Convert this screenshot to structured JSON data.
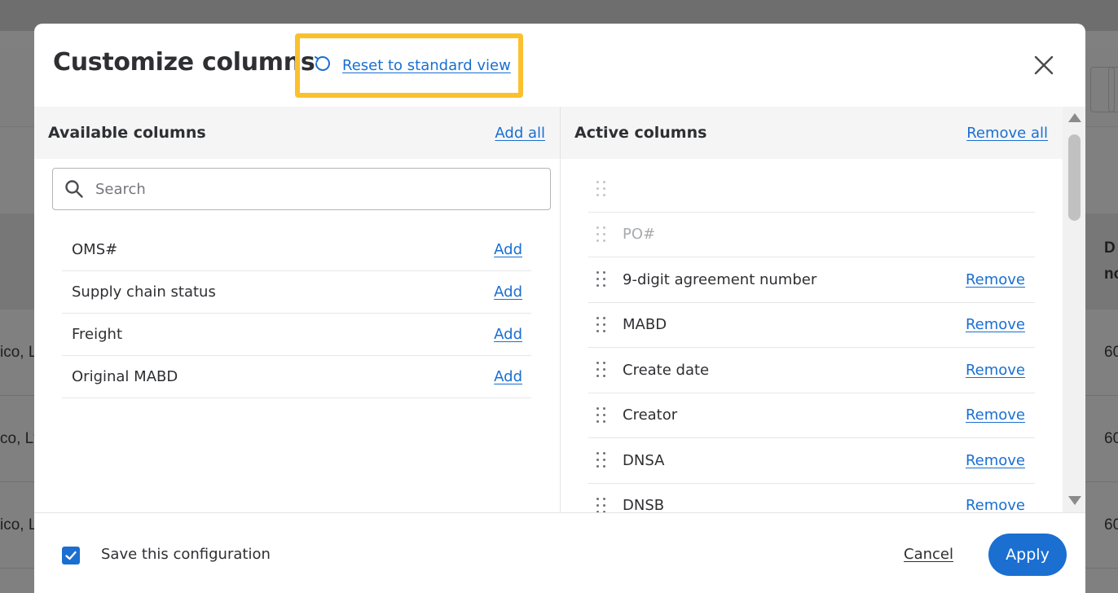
{
  "background": {
    "row_texts": [
      "ico, L",
      "co, Lt",
      "ico, L"
    ],
    "header_fragment_1": "D",
    "header_fragment_2": "no",
    "right_numbers": [
      "60",
      "60",
      "60"
    ]
  },
  "modal": {
    "title": "Customize columns",
    "reset_label": "Reset to standard view",
    "highlight_color": "#fbc02d"
  },
  "available": {
    "heading": "Available columns",
    "add_all_label": "Add all",
    "search_placeholder": "Search",
    "add_label": "Add",
    "items": [
      "OMS#",
      "Supply chain status",
      "Freight",
      "Original MABD"
    ]
  },
  "active": {
    "heading": "Active columns",
    "remove_all_label": "Remove all",
    "remove_label": "Remove",
    "locked_items": [
      "",
      "PO#"
    ],
    "items": [
      "9-digit agreement number",
      "MABD",
      "Create date",
      "Creator",
      "DNSA",
      "DNSB"
    ]
  },
  "footer": {
    "save_config_label": "Save this configuration",
    "save_config_checked": true,
    "cancel_label": "Cancel",
    "apply_label": "Apply"
  },
  "colors": {
    "accent": "#1a6fd1",
    "overlay": "#808080"
  }
}
